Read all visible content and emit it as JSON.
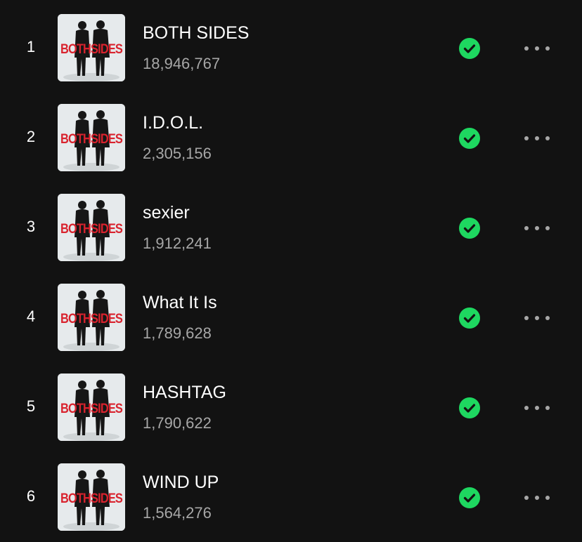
{
  "colors": {
    "background": "#121212",
    "title": "#ffffff",
    "subtitle": "#a7a7a7",
    "saved_green": "#1ed760",
    "cover_red": "#d9232e"
  },
  "tracks": [
    {
      "number": "1",
      "title": "BOTH SIDES",
      "plays": "18,946,767",
      "cover_text": "BOTHSIDES",
      "saved": true,
      "saved_icon": "check-circle-icon",
      "more_icon": "more-options-icon"
    },
    {
      "number": "2",
      "title": "I.D.O.L.",
      "plays": "2,305,156",
      "cover_text": "BOTHSIDES",
      "saved": true,
      "saved_icon": "check-circle-icon",
      "more_icon": "more-options-icon"
    },
    {
      "number": "3",
      "title": "sexier",
      "plays": "1,912,241",
      "cover_text": "BOTHSIDES",
      "saved": true,
      "saved_icon": "check-circle-icon",
      "more_icon": "more-options-icon"
    },
    {
      "number": "4",
      "title": "What It Is",
      "plays": "1,789,628",
      "cover_text": "BOTHSIDES",
      "saved": true,
      "saved_icon": "check-circle-icon",
      "more_icon": "more-options-icon"
    },
    {
      "number": "5",
      "title": "HASHTAG",
      "plays": "1,790,622",
      "cover_text": "BOTHSIDES",
      "saved": true,
      "saved_icon": "check-circle-icon",
      "more_icon": "more-options-icon"
    },
    {
      "number": "6",
      "title": "WIND UP",
      "plays": "1,564,276",
      "cover_text": "BOTHSIDES",
      "saved": true,
      "saved_icon": "check-circle-icon",
      "more_icon": "more-options-icon"
    }
  ]
}
